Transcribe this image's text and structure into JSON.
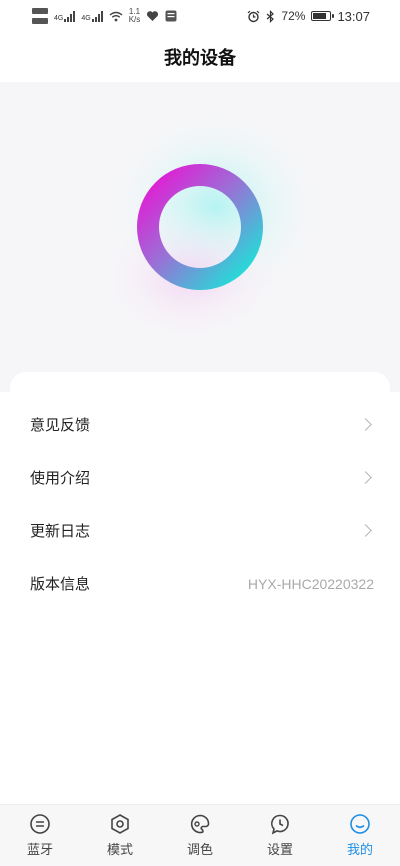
{
  "status_bar": {
    "network_speed_value": "1.1",
    "network_speed_unit": "K/s",
    "signal_1_label": "4G",
    "signal_2_label": "4G",
    "battery": "72%",
    "time": "13:07"
  },
  "header": {
    "title": "我的设备"
  },
  "menu": {
    "items": [
      {
        "label": "意见反馈"
      },
      {
        "label": "使用介绍"
      },
      {
        "label": "更新日志"
      },
      {
        "label": "版本信息",
        "value": "HYX-HHC20220322"
      }
    ]
  },
  "tabs": [
    {
      "label": "蓝牙",
      "icon": "bluetooth-icon"
    },
    {
      "label": "模式",
      "icon": "mode-hexagon-icon"
    },
    {
      "label": "调色",
      "icon": "palette-icon"
    },
    {
      "label": "设置",
      "icon": "settings-icon"
    },
    {
      "label": "我的",
      "icon": "profile-icon",
      "active": true
    }
  ],
  "colors": {
    "accent": "#1f8fe6",
    "ring_magenta": "#e01ad6",
    "ring_cyan": "#1ae6dc"
  }
}
